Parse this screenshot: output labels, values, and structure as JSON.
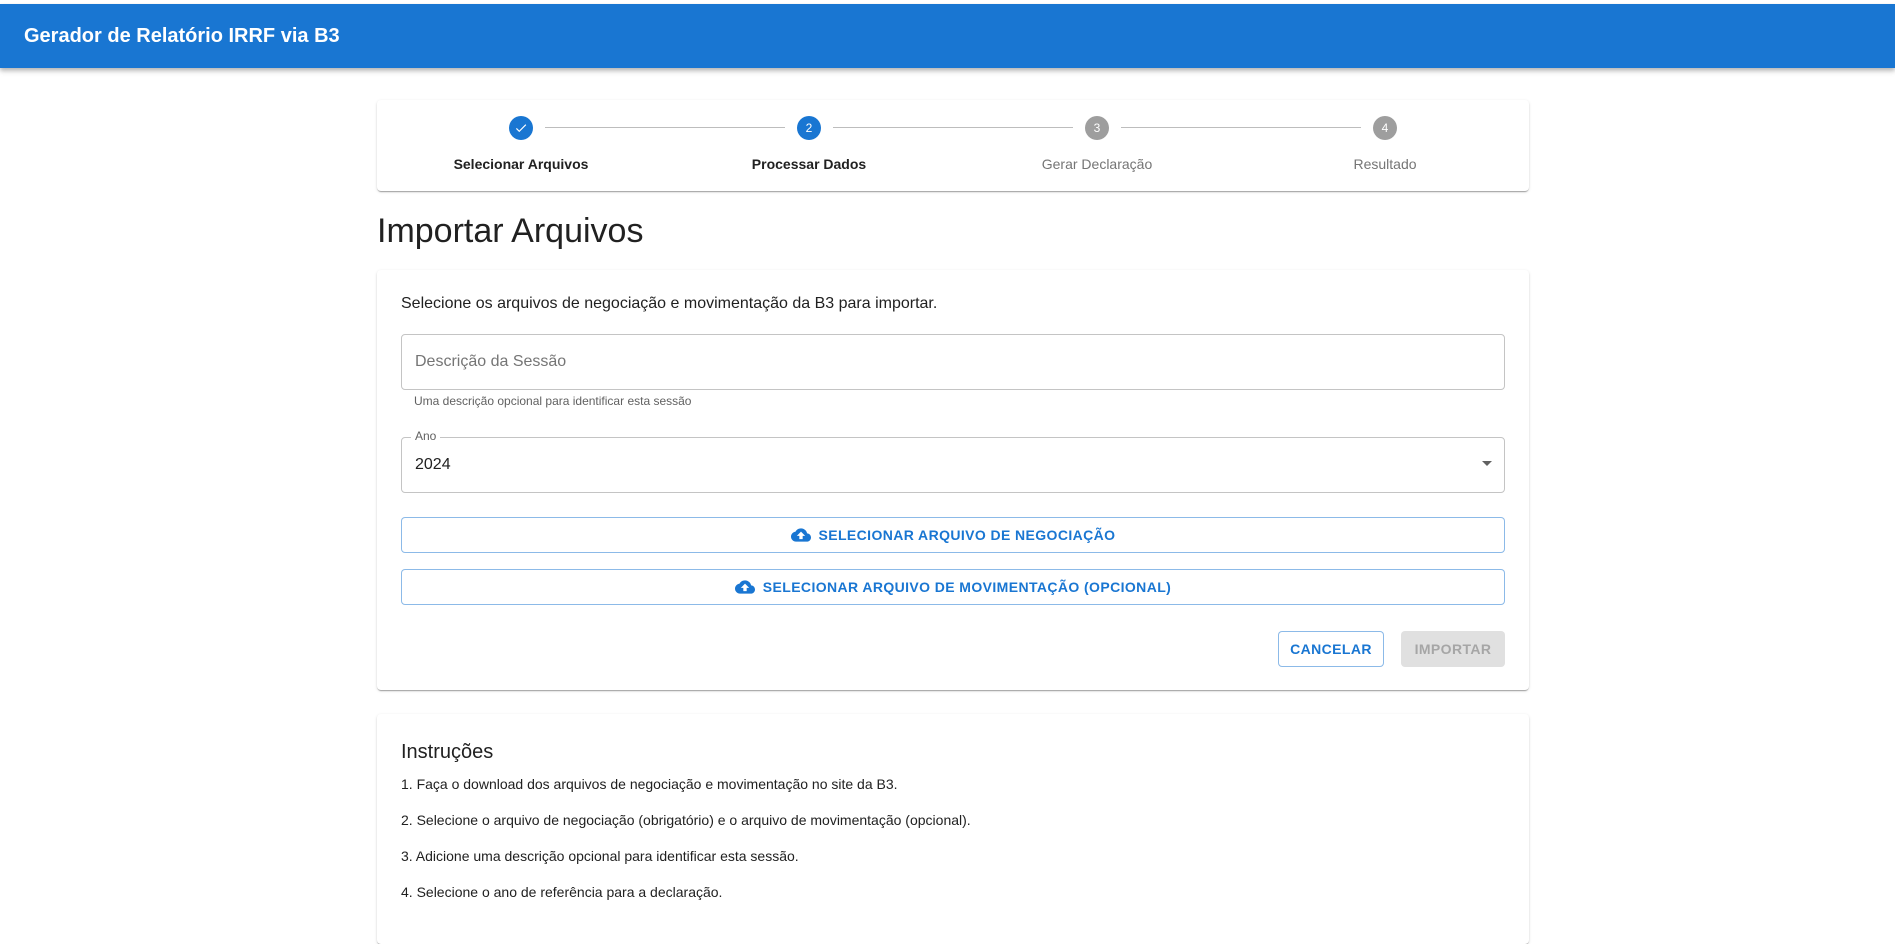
{
  "appbar": {
    "title": "Gerador de Relatório IRRF via B3"
  },
  "stepper": {
    "steps": [
      {
        "number": "",
        "label": "Selecionar Arquivos",
        "state": "completed"
      },
      {
        "number": "2",
        "label": "Processar Dados",
        "state": "active"
      },
      {
        "number": "3",
        "label": "Gerar Declaração",
        "state": "inactive"
      },
      {
        "number": "4",
        "label": "Resultado",
        "state": "inactive"
      }
    ]
  },
  "page": {
    "title": "Importar Arquivos"
  },
  "form": {
    "intro": "Selecione os arquivos de negociação e movimentação da B3 para importar.",
    "description_placeholder": "Descrição da Sessão",
    "description_value": "",
    "description_helper": "Uma descrição opcional para identificar esta sessão",
    "year_label": "Ano",
    "year_value": "2024",
    "select_negotiation_label": "SELECIONAR ARQUIVO DE NEGOCIAÇÃO",
    "select_movement_label": "SELECIONAR ARQUIVO DE MOVIMENTAÇÃO (OPCIONAL)",
    "cancel_label": "CANCELAR",
    "import_label": "IMPORTAR"
  },
  "instructions": {
    "title": "Instruções",
    "items": [
      "1. Faça o download dos arquivos de negociação e movimentação no site da B3.",
      "2. Selecione o arquivo de negociação (obrigatório) e o arquivo de movimentação (opcional).",
      "3. Adicione uma descrição opcional para identificar esta sessão.",
      "4. Selecione o ano de referência para a declaração."
    ]
  },
  "colors": {
    "primary": "#1976d2",
    "inactive_step": "#9e9e9e",
    "disabled_button_bg": "#e0e0e0"
  },
  "icons": {
    "completed_step": "check-icon",
    "upload": "cloud-upload-icon",
    "select_arrow": "arrow-drop-down-icon"
  }
}
